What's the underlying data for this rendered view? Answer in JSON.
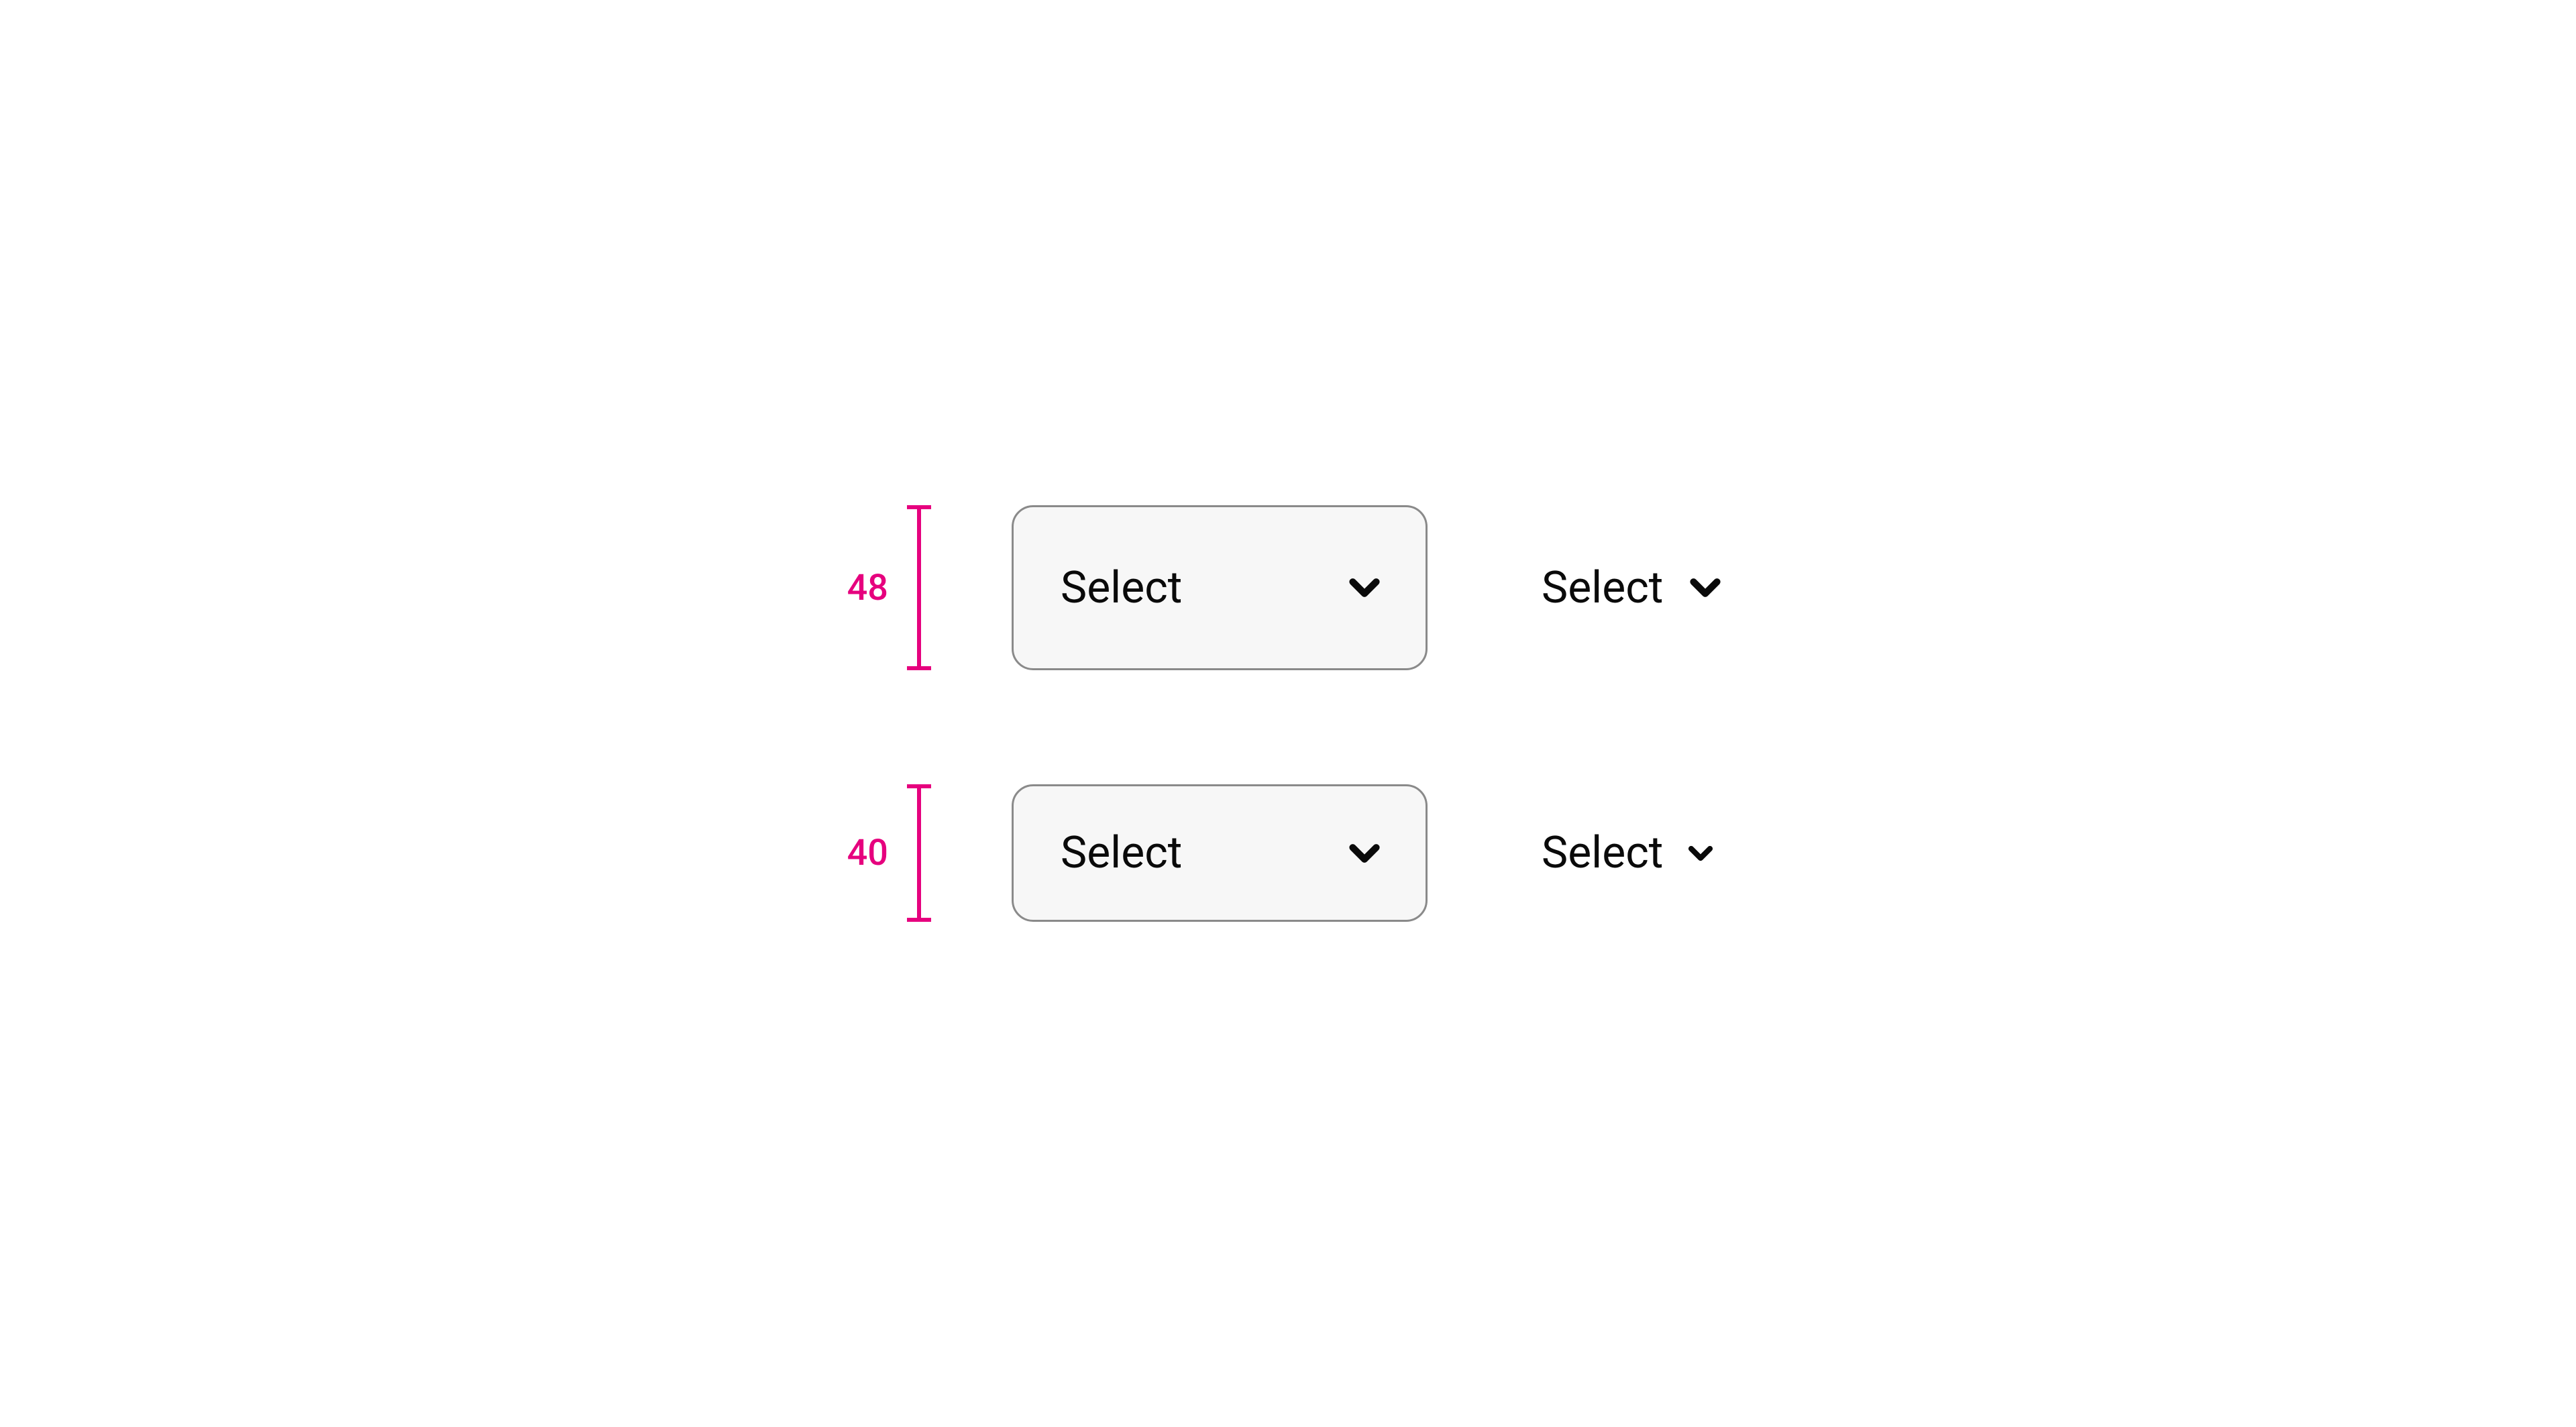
{
  "colors": {
    "accent": "#e6007e",
    "border": "#8a8a8a",
    "fill": "#f7f7f7",
    "text": "#0a0a0a"
  },
  "rows": [
    {
      "measure": "48",
      "boxed_label": "Select",
      "plain_label": "Select"
    },
    {
      "measure": "40",
      "boxed_label": "Select",
      "plain_label": "Select"
    }
  ]
}
